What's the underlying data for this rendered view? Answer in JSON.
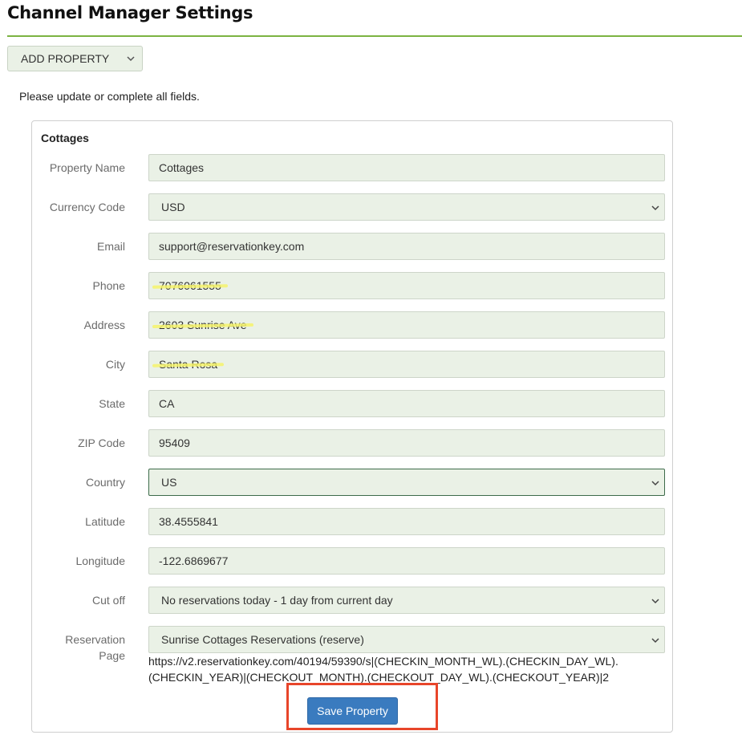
{
  "page": {
    "title": "Channel Manager Settings",
    "add_button_label": "ADD PROPERTY",
    "instructions": "Please update or complete all fields."
  },
  "property": {
    "heading": "Cottages",
    "fields": {
      "property_name": {
        "label": "Property Name",
        "value": "Cottages"
      },
      "currency_code": {
        "label": "Currency Code",
        "value": "USD"
      },
      "email": {
        "label": "Email",
        "value": "support@reservationkey.com"
      },
      "phone": {
        "label": "Phone",
        "value": "7076061555"
      },
      "address": {
        "label": "Address",
        "value": "2603 Sunrise Ave"
      },
      "city": {
        "label": "City",
        "value": "Santa Rosa"
      },
      "state": {
        "label": "State",
        "value": "CA"
      },
      "zip_code": {
        "label": "ZIP Code",
        "value": "95409"
      },
      "country": {
        "label": "Country",
        "value": "US"
      },
      "latitude": {
        "label": "Latitude",
        "value": "38.4555841"
      },
      "longitude": {
        "label": "Longitude",
        "value": "-122.6869677"
      },
      "cut_off": {
        "label": "Cut off",
        "value": "No reservations today - 1 day from current day"
      },
      "reservation_page": {
        "label_line1": "Reservation",
        "label_line2": "Page",
        "value": "Sunrise Cottages Reservations (reserve)",
        "url_line1": "https://v2.reservationkey.com/40194/59390/s|(CHECKIN_MONTH_WL).(CHECKIN_DAY_WL).",
        "url_line2": "(CHECKIN_YEAR)|(CHECKOUT_MONTH).(CHECKOUT_DAY_WL).(CHECKOUT_YEAR)|2"
      }
    },
    "save_button_label": "Save Property"
  },
  "icons": {
    "select_arrow": "chevron-down-icon"
  },
  "colors": {
    "accent_rule": "#7cb342",
    "field_bg": "#eaf1e6",
    "primary_button": "#3a7bbf",
    "highlight": "#e8452a",
    "redaction": "#f6f36a"
  }
}
